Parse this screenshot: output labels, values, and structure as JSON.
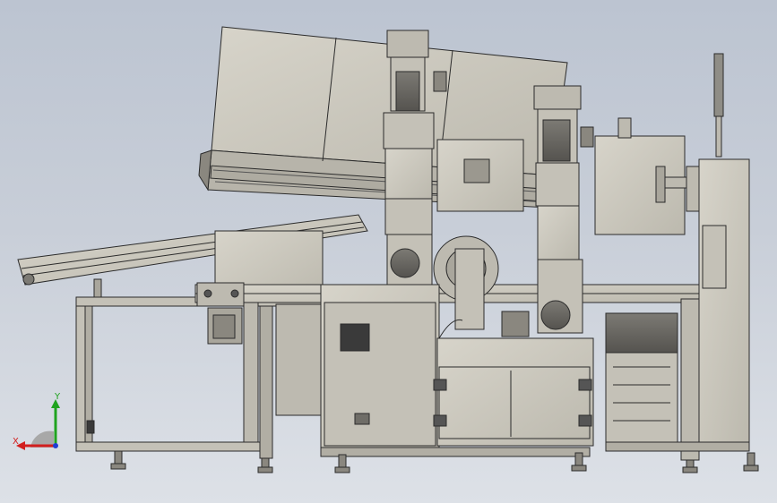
{
  "app": {
    "title": ""
  },
  "view": {
    "background_top": "#bcc4d1",
    "background_bottom": "#dde1e7",
    "model_fill": "#c9c6bc",
    "model_stroke": "#2b2b2b",
    "shadow_fill": "#9b988f"
  },
  "triad": {
    "x_label": "X",
    "y_label": "Y",
    "x_color": "#d21f1f",
    "y_color": "#1fa31f",
    "z_color": "#1f3fd2"
  }
}
